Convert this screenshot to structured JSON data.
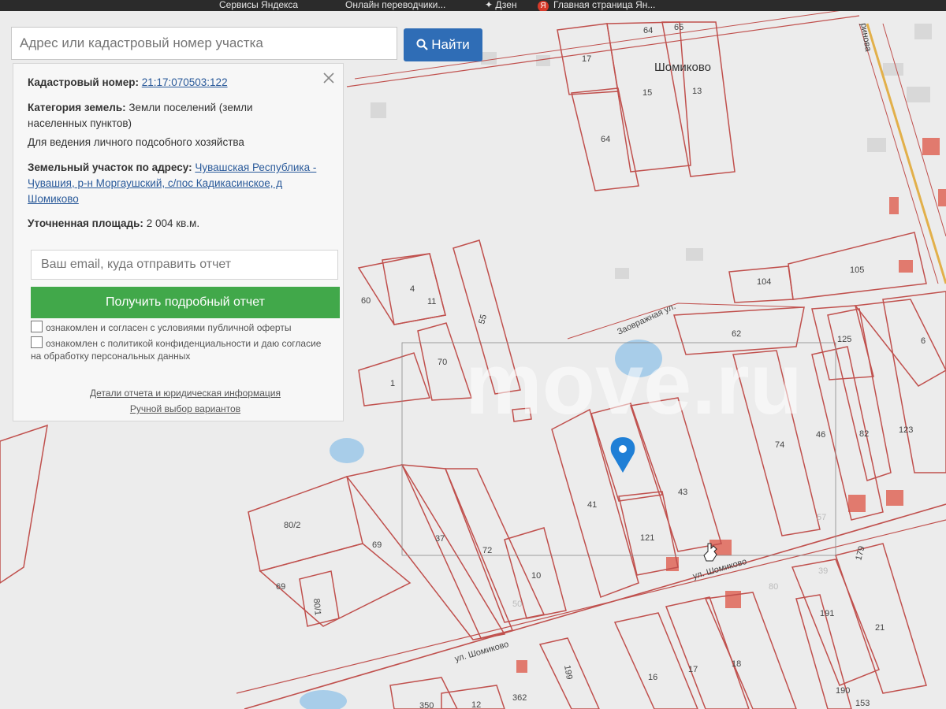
{
  "bookmarks": {
    "item1": "Сервисы Яндекса",
    "item2": "Онлайн переводчики...",
    "item3": "Дзен",
    "item4": "Главная страница Ян..."
  },
  "search": {
    "placeholder": "Адрес или кадастровый номер участка",
    "button": "Найти"
  },
  "info": {
    "cadastral_label": "Кадастровый номер:",
    "cadastral_value": "21:17:070503:122",
    "category_label": "Категория земель:",
    "category_value": "Земли поселений (земли населенных пунктов)",
    "usage": "Для ведения личного подсобного хозяйства",
    "address_label": "Земельный участок по адресу:",
    "address_value": "Чувашская Республика - Чувашия, р-н Моргаушский, с/пос Кадикасинское, д Шомиково",
    "area_label": "Уточненная площадь:",
    "area_value": "2 004 кв.м."
  },
  "report": {
    "email_placeholder": "Ваш email, куда отправить отчет",
    "button": "Получить подробный отчет",
    "agree_offer": "ознакомлен и согласен с условиями публичной оферты",
    "agree_privacy": "ознакомлен с политикой конфиденциальности и даю согласие на обработку персональных данных",
    "link_details": "Детали отчета и юридическая информация",
    "link_manual": "Ручной выбор вариантов"
  },
  "map_labels": {
    "village": "Шомиково",
    "street_shomikovo": "ул. Шомиково",
    "street_zaovrazhnaya": "Заовражная ул.",
    "street_right": "ринова",
    "watermark": "move.ru",
    "plots": [
      "64",
      "65",
      "17",
      "15",
      "13",
      "64",
      "104",
      "105",
      "62",
      "125",
      "6",
      "123",
      "82",
      "46",
      "74",
      "43",
      "41",
      "121",
      "60",
      "4",
      "11",
      "55",
      "70",
      "1",
      "80/2",
      "69",
      "37",
      "72",
      "10",
      "50",
      "69",
      "80/1",
      "39",
      "191",
      "21",
      "179",
      "18",
      "17",
      "16",
      "199",
      "362",
      "12",
      "350",
      "190",
      "153",
      "57",
      "80"
    ]
  },
  "colors": {
    "map_bg": "#ececec",
    "plot_line": "#c0504d",
    "search_button": "#2f6db6",
    "report_button": "#41a84a",
    "link": "#2a5a9a",
    "marker": "#1f7fd6"
  }
}
